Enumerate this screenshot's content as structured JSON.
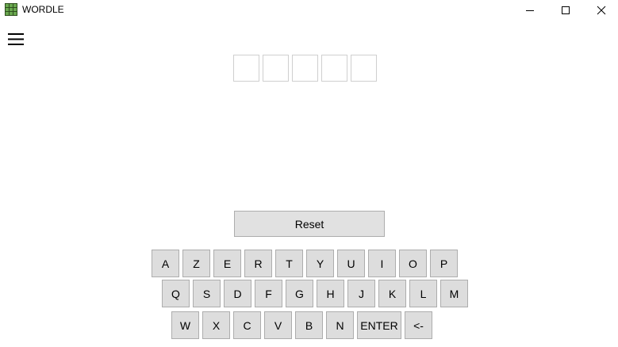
{
  "window": {
    "title": "WORDLE",
    "icon": "wordle-grid-icon",
    "controls": [
      "minimize-icon",
      "maximize-icon",
      "close-icon"
    ]
  },
  "menu": {
    "icon": "hamburger-menu-icon"
  },
  "board": {
    "tiles": [
      "",
      "",
      "",
      "",
      ""
    ]
  },
  "reset_label": "Reset",
  "keyboard": {
    "row1": [
      "A",
      "Z",
      "E",
      "R",
      "T",
      "Y",
      "U",
      "I",
      "O",
      "P"
    ],
    "row2": [
      "Q",
      "S",
      "D",
      "F",
      "G",
      "H",
      "J",
      "K",
      "L",
      "M"
    ],
    "row3": [
      "W",
      "X",
      "C",
      "V",
      "B",
      "N",
      "ENTER",
      "<-"
    ]
  },
  "colors": {
    "key_background": "#dddddd",
    "key_border": "#adadad",
    "tile_border": "#cfcfcf",
    "icon_green": "#5a8a3a"
  }
}
